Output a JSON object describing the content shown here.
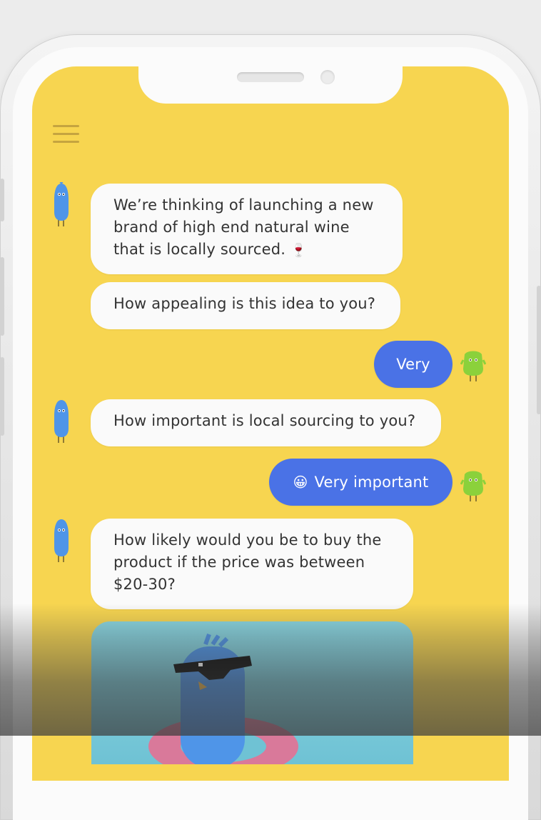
{
  "colors": {
    "screen_bg": "#f7d550",
    "bot_bubble": "#fafafa",
    "user_bubble": "#4a72e6",
    "bot_avatar": "#4f95e8",
    "user_avatar": "#8bd13b"
  },
  "icons": {
    "menu": "hamburger-menu-icon",
    "wine": "wine-glass-emoji",
    "grin": "grinning-face-emoji"
  },
  "messages": [
    {
      "sender": "bot",
      "text": "We’re thinking of launching a new brand of high end natural wine that is locally sourced.",
      "emoji": "🍷"
    },
    {
      "sender": "bot",
      "text": "How appealing is this idea to you?"
    },
    {
      "sender": "user",
      "text": "Very"
    },
    {
      "sender": "bot",
      "text": "How important is local sourcing to you?"
    },
    {
      "sender": "user",
      "text": "Very important",
      "emoji": "😀"
    },
    {
      "sender": "bot",
      "text": "How likely would you be to buy the product if the price was between $20-30?"
    }
  ]
}
